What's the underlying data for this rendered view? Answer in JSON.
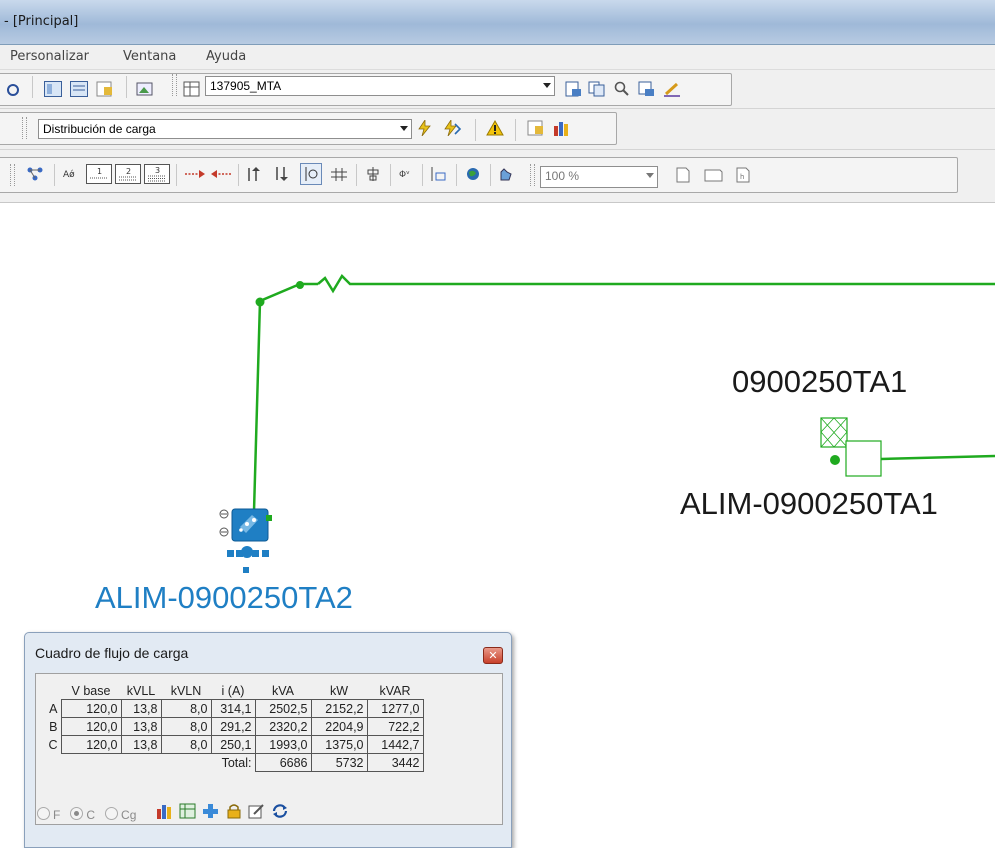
{
  "window": {
    "title": "- [Principal]"
  },
  "menu": [
    "Personalizar",
    "Ventana",
    "Ayuda"
  ],
  "toolbar": {
    "feeder_select": "137905_MTA",
    "analysis_select": "Distribución de carga",
    "zoom_select": "100 %"
  },
  "diagram": {
    "transformer_label": "0900250TA1",
    "feeder_label_right": "ALIM-0900250TA1",
    "feeder_label_left": "ALIM-0900250TA2",
    "colors": {
      "line": "#1faa1f",
      "selected": "#1f7fc4",
      "text": "#1a1a1a"
    }
  },
  "load_flow": {
    "title": "Cuadro de flujo de carga",
    "headers": [
      "",
      "V base",
      "kVLL",
      "kVLN",
      "i (A)",
      "kVA",
      "kW",
      "kVAR"
    ],
    "rows": [
      [
        "A",
        "120,0",
        "13,8",
        "8,0",
        "314,1",
        "2502,5",
        "2152,2",
        "1277,0"
      ],
      [
        "B",
        "120,0",
        "13,8",
        "8,0",
        "291,2",
        "2320,2",
        "2204,9",
        "722,2"
      ],
      [
        "C",
        "120,0",
        "13,8",
        "8,0",
        "250,1",
        "1993,0",
        "1375,0",
        "1442,7"
      ]
    ],
    "total_label": "Total:",
    "totals": [
      "6686",
      "5732",
      "3442"
    ],
    "options": {
      "f": "F",
      "c": "C",
      "cg": "Cg",
      "selected": "C"
    }
  }
}
